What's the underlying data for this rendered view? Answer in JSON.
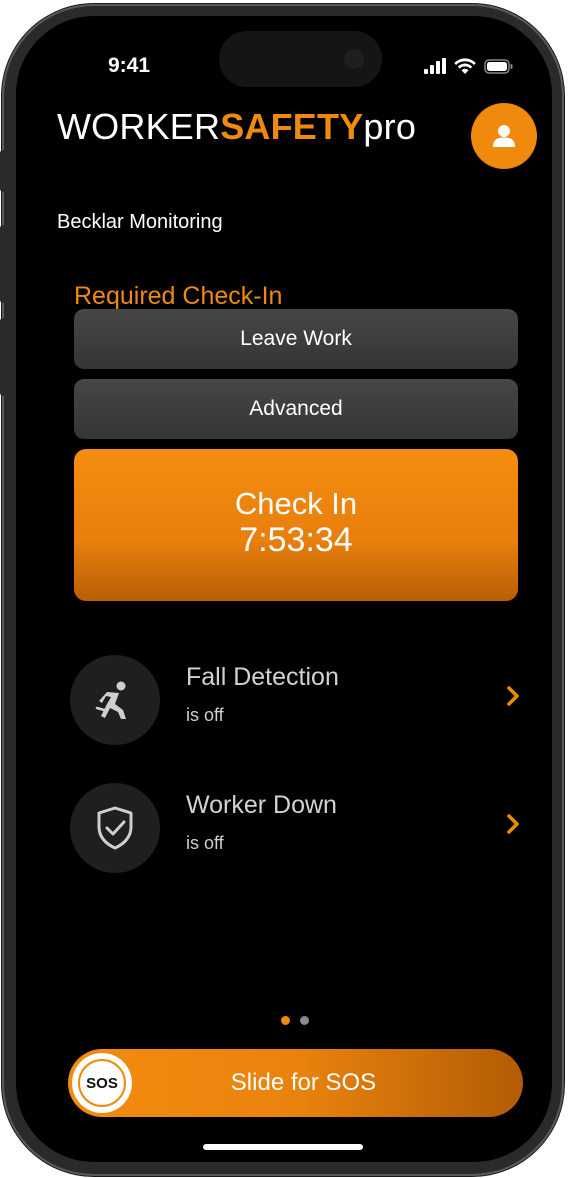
{
  "status_bar": {
    "time": "9:41"
  },
  "header": {
    "logo_part1": "WORKER",
    "logo_part2": "SAFETY",
    "logo_part3": "pro"
  },
  "company": "Becklar Monitoring",
  "checkin": {
    "section_title": "Required Check-In",
    "leave_work_label": "Leave Work",
    "advanced_label": "Advanced",
    "button_label": "Check In",
    "timer": "7:53:34"
  },
  "features": [
    {
      "title": "Fall Detection",
      "status": "is off",
      "icon": "falling-person-icon"
    },
    {
      "title": "Worker Down",
      "status": "is off",
      "icon": "shield-check-icon"
    }
  ],
  "pagination": {
    "active_index": 0,
    "count": 2
  },
  "sos": {
    "knob_label": "SOS",
    "slider_label": "Slide for SOS"
  },
  "colors": {
    "accent": "#f08a0d",
    "background": "#000000",
    "button_gray": "#3d3d3d"
  }
}
